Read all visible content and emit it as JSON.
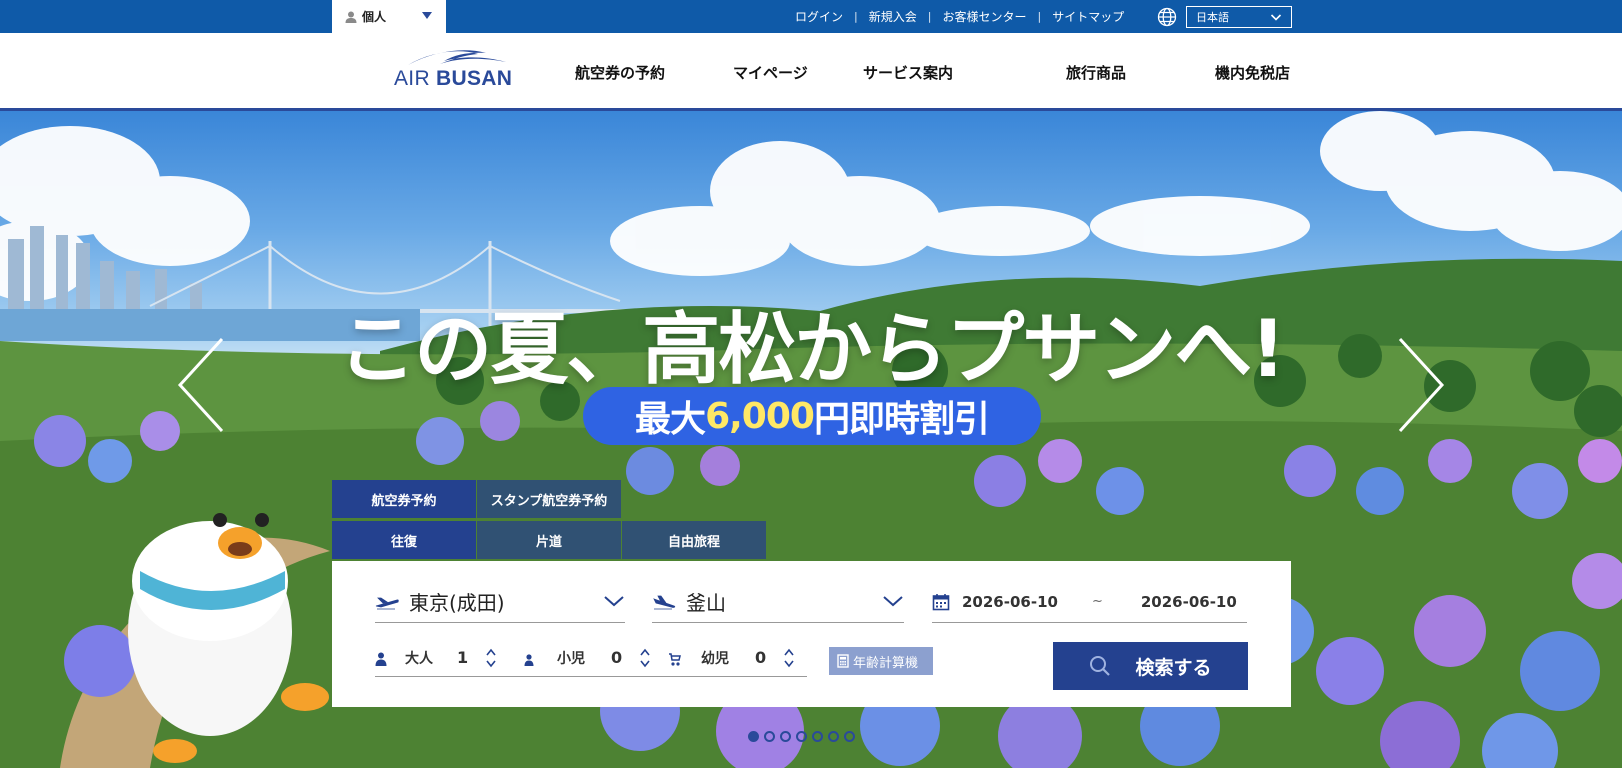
{
  "topbar": {
    "account_type": "個人",
    "links": [
      "ログイン",
      "新規入会",
      "お客様センター",
      "サイトマップ"
    ],
    "language": "日本語"
  },
  "header": {
    "logo_text_light": "AIR ",
    "logo_text_bold": "BUSAN",
    "nav": [
      "航空券の予約",
      "マイページ",
      "サービス案内",
      "旅行商品",
      "機内免税店"
    ]
  },
  "hero": {
    "title": "この夏、高松からプサンへ!",
    "pill_prefix": "最大",
    "pill_highlight": "6,000",
    "pill_suffix": "円即時割引",
    "slide_count": 7,
    "active_slide": 1
  },
  "booking": {
    "tabs_type": [
      "航空券予約",
      "スタンプ航空券予約"
    ],
    "tabs_trip": [
      "往復",
      "片道",
      "自由旅程"
    ],
    "origin": "東京(成田)",
    "destination": "釜山",
    "depart_date": "2026-06-10",
    "date_separator": "~",
    "return_date": "2026-06-10",
    "passengers": [
      {
        "label": "大人",
        "count": "1"
      },
      {
        "label": "小児",
        "count": "0"
      },
      {
        "label": "幼児",
        "count": "0"
      }
    ],
    "age_calc": "年齢計算機",
    "search": "検索する"
  },
  "colors": {
    "topbar": "#0f5aa8",
    "brand": "#24418f",
    "pill": "#2f63e3",
    "highlight": "#ffe866"
  }
}
